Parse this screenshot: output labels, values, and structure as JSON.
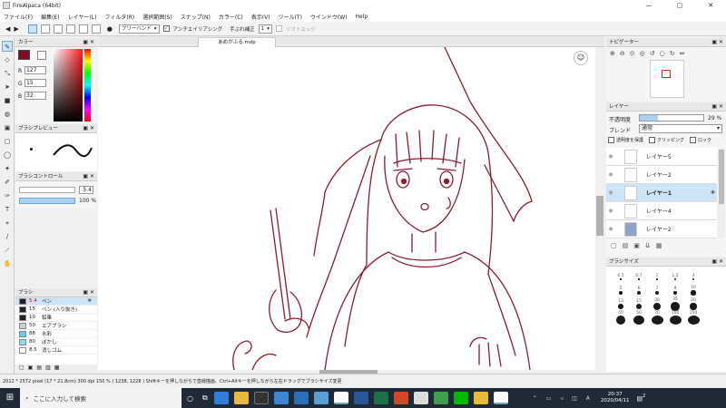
{
  "window": {
    "title": "FireAlpaca (64bit)",
    "controls": [
      "—",
      "▢",
      "✕"
    ]
  },
  "menu": [
    "ファイル(F)",
    "編集(E)",
    "レイヤー(L)",
    "フィルタ(R)",
    "選択範囲(S)",
    "スナップ(N)",
    "カラー(C)",
    "表示(V)",
    "ツール(T)",
    "ウインドウ(W)",
    "Help"
  ],
  "toolbar": {
    "mode_select": "フリーハンド",
    "antialias_label": "アンチエイリアシング",
    "antialias_checked": true,
    "stabilizer_label": "手ぶれ補正",
    "stabilizer_value": "1",
    "soft_edge_label": "ソフトエッジ"
  },
  "document_tab": "あめがふる.mdp",
  "color_panel": {
    "title": "カラー",
    "r_label": "R",
    "r": "127",
    "g_label": "G",
    "g": "15",
    "b_label": "B",
    "b": "32",
    "current_color": "#7f0f20"
  },
  "brush_preview_panel": {
    "title": "ブラシプレビュー"
  },
  "brush_control_panel": {
    "title": "ブラシコントロール",
    "size": "5.4",
    "opacity": "100 %"
  },
  "brush_panel": {
    "title": "ブラシ",
    "items": [
      {
        "size": "5.4",
        "name": "ペン",
        "color": "#222222",
        "selected": true
      },
      {
        "size": "15",
        "name": "ペン (入り抜き)",
        "color": "#222222"
      },
      {
        "size": "10",
        "name": "鉛筆",
        "color": "#222222"
      },
      {
        "size": "50",
        "name": "エアブラシ",
        "color": "#cccccc"
      },
      {
        "size": "88",
        "name": "水彩",
        "color": "#66ccee"
      },
      {
        "size": "80",
        "name": "ぼかし",
        "color": "#88ddff"
      },
      {
        "size": "8.5",
        "name": "消しゴム",
        "color": "#ffffff"
      }
    ]
  },
  "navigator_panel": {
    "title": "ナビゲーター"
  },
  "layer_panel": {
    "title": "レイヤー",
    "opacity_label": "不透明度",
    "opacity": "29 %",
    "blend_label": "ブレンド",
    "blend": "通常",
    "protect_alpha": "透明度を保護",
    "clipping": "クリッピング",
    "lock": "ロック",
    "layers": [
      {
        "name": "レイヤー5",
        "selected": false
      },
      {
        "name": "レイヤー2",
        "selected": false
      },
      {
        "name": "レイヤー1",
        "selected": true
      },
      {
        "name": "レイヤー4",
        "selected": false
      },
      {
        "name": "レイヤー2",
        "selected": false
      }
    ]
  },
  "brush_size_panel": {
    "title": "ブラシサイズ",
    "sizes": [
      "0.5",
      "0.7",
      "1",
      "1.5",
      "3",
      "5",
      "6",
      "7",
      "8",
      "10",
      "13",
      "15",
      "30",
      "35",
      "20",
      "40",
      "50",
      "70",
      "100",
      "150"
    ]
  },
  "status": {
    "text": "2012 * 2572 pixel  (17 * 21.8cm)  300 dpi  150 %  ( 1238, 1228 )  Shiftキーを押しながらで直線描画、Ctrl+Altキーを押しながら左右ドラッグでブラシサイズ変更"
  },
  "taskbar": {
    "search_placeholder": "ここに入力して検索",
    "time": "20:37",
    "date": "2020/04/11",
    "notification_count": "2"
  }
}
